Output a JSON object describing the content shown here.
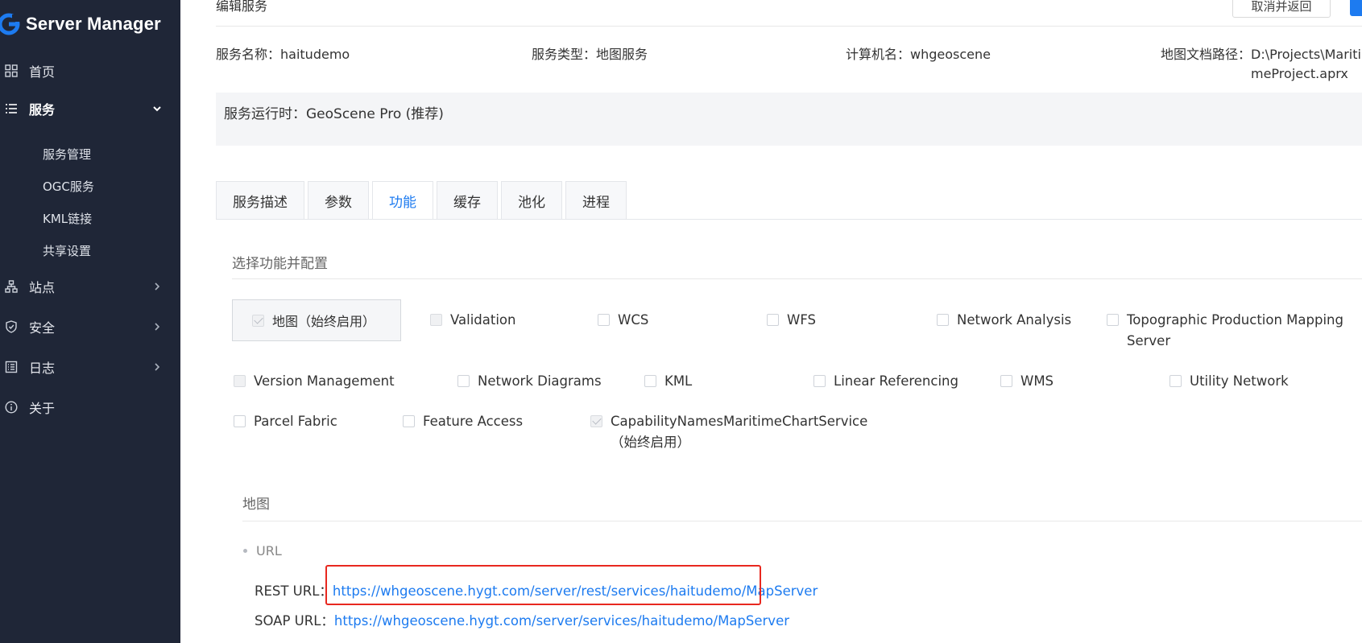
{
  "brand": {
    "name": "Server Manager",
    "accent": "#1d7bf0"
  },
  "sidebar": {
    "items": [
      {
        "label": "首页",
        "icon": "grid-icon"
      },
      {
        "label": "服务",
        "icon": "list-icon",
        "expanded": true
      },
      {
        "label": "站点",
        "icon": "sitemap-icon"
      },
      {
        "label": "安全",
        "icon": "shield-icon"
      },
      {
        "label": "日志",
        "icon": "log-icon"
      },
      {
        "label": "关于",
        "icon": "info-icon"
      }
    ],
    "subitems": [
      "服务管理",
      "OGC服务",
      "KML链接",
      "共享设置"
    ]
  },
  "header": {
    "title": "编辑服务",
    "cancel_label": "取消并返回"
  },
  "info": {
    "service_name_label": "服务名称：",
    "service_name": "haitudemo",
    "service_type_label": "服务类型：",
    "service_type": "地图服务",
    "machine_label": "计算机名：",
    "machine": "whgeoscene",
    "doc_path_label": "地图文档路径：",
    "doc_path_line1": "D:\\Projects\\Mariti",
    "doc_path_line2": "meProject.aprx"
  },
  "runtime": {
    "label": "服务运行时：",
    "value": "GeoScene Pro (推荐)"
  },
  "tabs": [
    "服务描述",
    "参数",
    "功能",
    "缓存",
    "池化",
    "进程"
  ],
  "active_tab": "功能",
  "capabilities": {
    "section_title": "选择功能并配置",
    "map": "地图（始终启用）",
    "items": [
      "Validation",
      "WCS",
      "WFS",
      "Network Analysis",
      "Topographic Production Mapping",
      "Server",
      "Version Management",
      "Network Diagrams",
      "KML",
      "Linear Referencing",
      "WMS",
      "Utility Network",
      "Parcel Fabric",
      "Feature Access",
      "CapabilityNamesMaritimeChartService",
      "（始终启用）"
    ]
  },
  "map_section": {
    "title": "地图",
    "url_heading": "URL",
    "rest_label": "REST URL：",
    "rest_url": "https://whgeoscene.hygt.com/server/rest/services/haitudemo/MapServer",
    "soap_label": "SOAP URL：",
    "soap_url": "https://whgeoscene.hygt.com/server/services/haitudemo/MapServer"
  }
}
